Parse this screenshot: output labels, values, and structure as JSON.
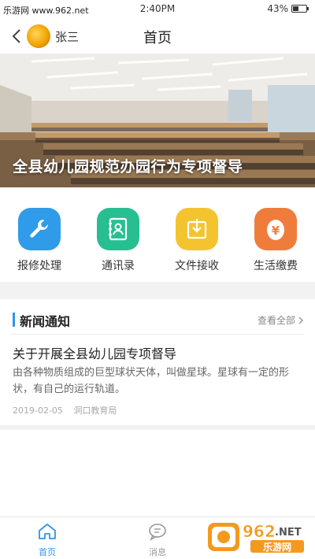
{
  "status": {
    "watermark": "乐游网 www.962.net",
    "time": "2:40PM",
    "battery": "43%",
    "battery_level": 0.43
  },
  "header": {
    "username": "张三",
    "title": "首页"
  },
  "banner": {
    "caption": "全县幼儿园规范办园行为专项督导"
  },
  "quick_actions": [
    {
      "label": "报修处理",
      "icon": "wrench-icon",
      "color": "#2f9be9"
    },
    {
      "label": "通讯录",
      "icon": "contacts-icon",
      "color": "#27bf91"
    },
    {
      "label": "文件接收",
      "icon": "download-file-icon",
      "color": "#f4c430"
    },
    {
      "label": "生活缴费",
      "icon": "yuan-payment-icon",
      "color": "#f07c3c"
    }
  ],
  "news": {
    "section_title": "新闻通知",
    "view_all": "查看全部",
    "article": {
      "title": "关于开展全县幼儿园专项督导",
      "summary": "由各种物质组成的巨型球状天体，叫做星球。星球有一定的形状，有自己的运行轨道。",
      "date": "2019-02-05",
      "source": "洞口教育局"
    }
  },
  "tabbar": {
    "tabs": [
      {
        "label": "首页",
        "icon": "home-icon",
        "active": true
      },
      {
        "label": "消息",
        "icon": "message-icon",
        "active": false
      }
    ],
    "active_color": "#2f96e8",
    "inactive_color": "#999999"
  },
  "watermark_logo": {
    "number": "962",
    "suffix": ".NET",
    "cn": "乐游网"
  }
}
